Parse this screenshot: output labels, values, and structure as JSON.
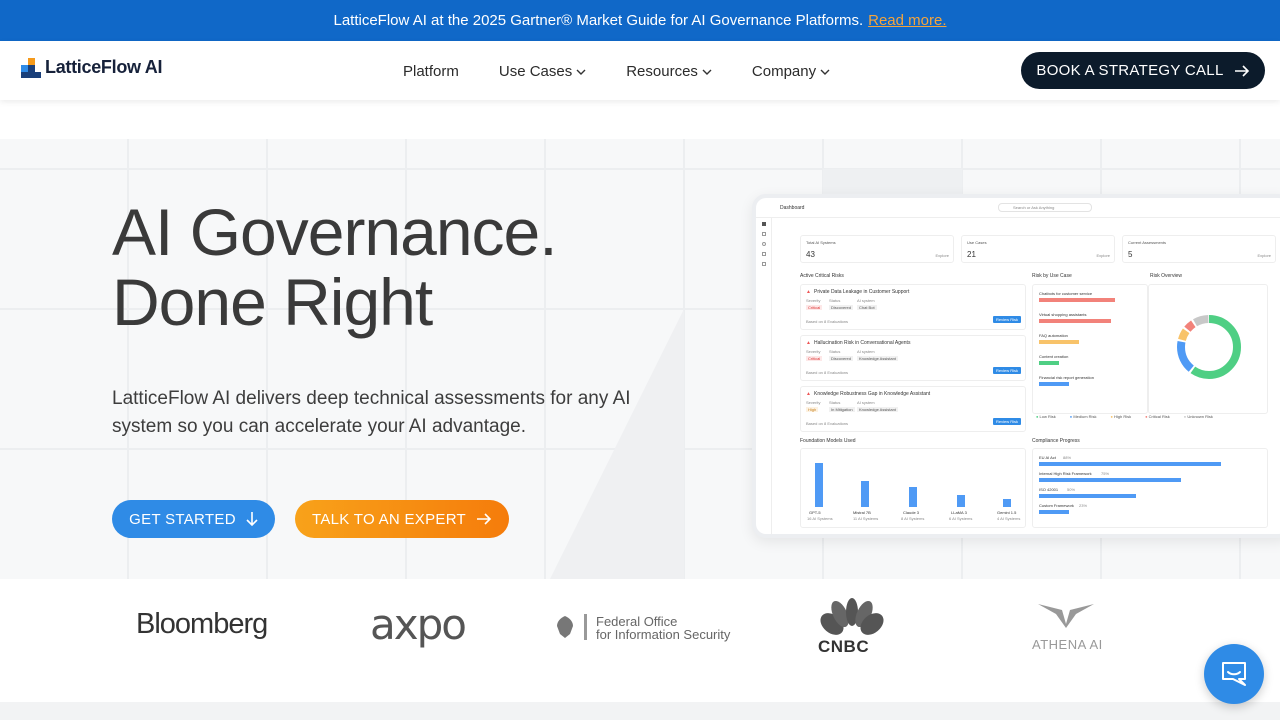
{
  "banner": {
    "text": "LatticeFlow AI at the 2025 Gartner® Market Guide for AI Governance Platforms.",
    "link": "Read more."
  },
  "nav": {
    "logo": "LatticeFlow AI",
    "items": [
      "Platform",
      "Use Cases",
      "Resources",
      "Company"
    ],
    "cta": "BOOK A STRATEGY CALL"
  },
  "hero": {
    "title_line1": "AI Governance.",
    "title_line2": "Done Right",
    "subtitle": "LatticeFlow AI delivers deep technical assessments for any AI system so you can accelerate your AI advantage.",
    "btn_start": "GET STARTED",
    "btn_expert": "TALK TO AN EXPERT"
  },
  "dashboard": {
    "title": "Dashboard",
    "search": "Search or Ask Anything",
    "stats": [
      {
        "label": "Total AI Systems",
        "value": "43",
        "link": "Explore"
      },
      {
        "label": "Use Cases",
        "value": "21",
        "link": "Explore"
      },
      {
        "label": "Current Assessments",
        "value": "5",
        "link": "Explore"
      }
    ],
    "risks_title": "Active Critical Risks",
    "risks": [
      {
        "title": "Private Data Leakage in Customer Support",
        "severity": "Critical",
        "status": "Discovered",
        "system": "Chat Bot",
        "based": "Based on 8 Evaluations"
      },
      {
        "title": "Hallucination Risk in Conversational Agents",
        "severity": "Critical",
        "status": "Discovered",
        "system": "Knowledge Assistant",
        "based": "Based on 8 Evaluations"
      },
      {
        "title": "Knowledge Robustness Gap in Knowledge Assistant",
        "severity": "High",
        "status": "In Mitigation",
        "system": "Knowledge Assistant",
        "based": "Based on 8 Evaluations"
      }
    ],
    "review_label": "Review Risk",
    "col_severity": "Severity",
    "col_status": "Status",
    "col_system": "AI system",
    "usecase_title": "Risk by Use Case",
    "usecases": [
      "Chatbots for customer service",
      "Virtual shopping assistants",
      "FAQ automation",
      "Content creation",
      "Financial risk report generation"
    ],
    "overview_title": "Risk Overview",
    "legend": [
      "Low Risk",
      "Medium Risk",
      "High Risk",
      "Critical Risk",
      "Unknown Risk"
    ],
    "models_title": "Foundation Models Used",
    "models": [
      {
        "name": "GPT-5",
        "count": "16 AI Systems"
      },
      {
        "name": "Mistral 7B",
        "count": "11 AI Systems"
      },
      {
        "name": "Claude 3",
        "count": "8 AI Systems"
      },
      {
        "name": "LLaMA 3",
        "count": "6 AI Systems"
      },
      {
        "name": "Gemini 1.5",
        "count": "4 AI Systems"
      }
    ],
    "compliance_title": "Compliance Progress",
    "compliance": [
      {
        "name": "EU AI Act",
        "pct": "88%"
      },
      {
        "name": "Internal High Risk Framework",
        "pct": "75%"
      },
      {
        "name": "ISO 42001",
        "pct": "50%"
      },
      {
        "name": "Custom Framework",
        "pct": "23%"
      }
    ]
  },
  "logos": {
    "bloomberg": "Bloomberg",
    "axpo": "axpo",
    "bsi_line1": "Federal Office",
    "bsi_line2": "for Information Security",
    "cnbc": "CNBC",
    "athena": "ATHENA AI"
  },
  "colors": {
    "banner": "#1068c8",
    "accent_blue": "#2f8be6",
    "accent_orange": "#f57c0b",
    "dark": "#0c1b2b"
  }
}
